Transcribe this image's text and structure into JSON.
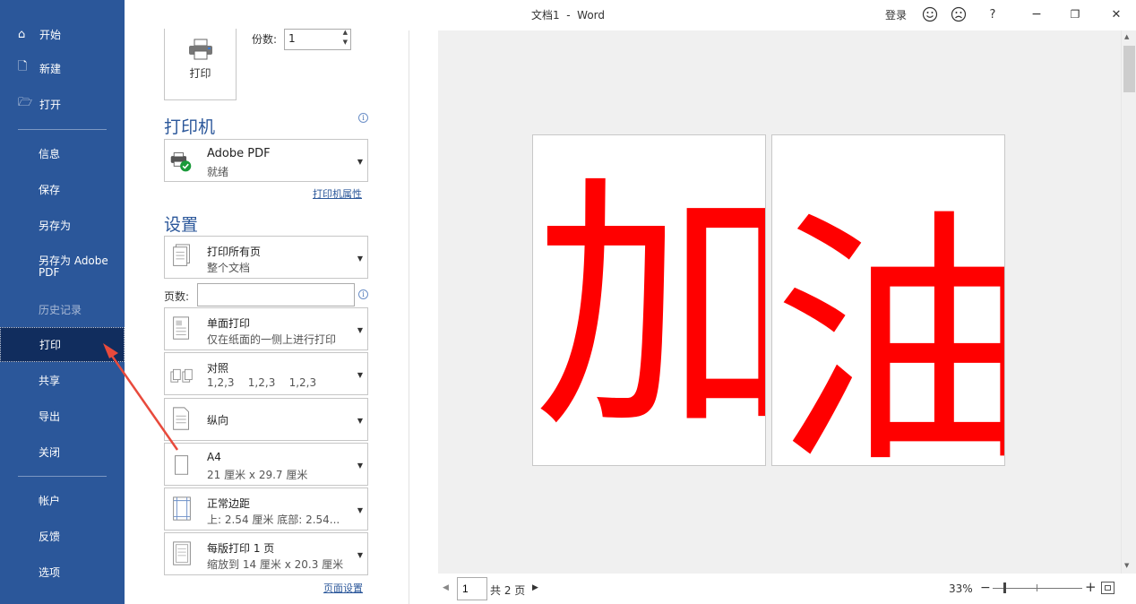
{
  "window": {
    "title": "文档1  -  Word",
    "login_label": "登录",
    "help_label": "?",
    "minimize_label": "−",
    "restore_label": "❐",
    "close_label": "✕",
    "smile_icon": "smile-icon",
    "frown_icon": "frown-icon"
  },
  "sidebar": {
    "items": [
      {
        "label": "开始",
        "icon": "home-icon"
      },
      {
        "label": "新建",
        "icon": "new-doc-icon"
      },
      {
        "label": "打开",
        "icon": "folder-open-icon"
      },
      {
        "label": "信息"
      },
      {
        "label": "保存"
      },
      {
        "label": "另存为"
      },
      {
        "label": "另存为 Adobe PDF"
      },
      {
        "label": "历史记录",
        "disabled": true
      },
      {
        "label": "打印",
        "active": true
      },
      {
        "label": "共享"
      },
      {
        "label": "导出"
      },
      {
        "label": "关闭"
      },
      {
        "label": "帐户"
      },
      {
        "label": "反馈"
      },
      {
        "label": "选项"
      }
    ],
    "colors": {
      "background": "#2b579a",
      "active": "#112d5e"
    }
  },
  "print": {
    "print_button_label": "打印",
    "copies_label": "份数:",
    "copies_value": "1",
    "printer_section_title": "打印机",
    "printer": {
      "name": "Adobe PDF",
      "status": "就绪"
    },
    "printer_properties_link": "打印机属性",
    "settings_section_title": "设置",
    "pages_label": "页数:",
    "pages_value": "",
    "settings": [
      {
        "main": "打印所有页",
        "sub": "整个文档",
        "icon": "pages-icon"
      },
      {
        "main": "单面打印",
        "sub": "仅在纸面的一侧上进行打印",
        "icon": "single-sided-icon"
      },
      {
        "main": "对照",
        "sub": "1,2,3    1,2,3    1,2,3",
        "icon": "collate-icon"
      },
      {
        "main": "纵向",
        "sub": "",
        "icon": "portrait-icon"
      },
      {
        "main": "A4",
        "sub": "21 厘米 x 29.7 厘米",
        "icon": "paper-size-icon"
      },
      {
        "main": "正常边距",
        "sub": "上: 2.54 厘米 底部: 2.54...",
        "icon": "margins-icon"
      },
      {
        "main": "每版打印 1 页",
        "sub": "缩放到 14 厘米 x 20.3 厘米",
        "icon": "pages-per-sheet-icon"
      }
    ],
    "page_setup_link": "页面设置"
  },
  "preview": {
    "pages": [
      {
        "text": "加"
      },
      {
        "text": "油"
      }
    ],
    "text_color": "#ff0000",
    "page_number_value": "1",
    "total_pages_label": "共 2 页",
    "zoom_label": "33%",
    "zoom_level_percent": 33
  }
}
